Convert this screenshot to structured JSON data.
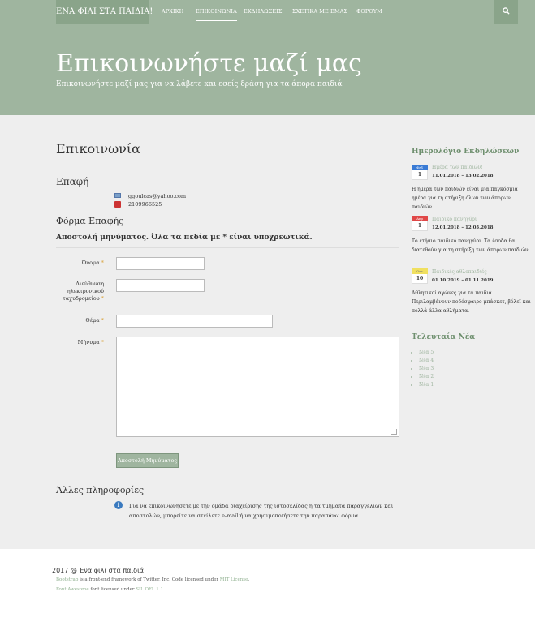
{
  "navbar": {
    "brand": "ΕΝΑ ΦΙΛΙ ΣΤΑ ΠΑΙΔΙΑ!",
    "items": [
      {
        "label": "ΑΡΧΙΚΗ"
      },
      {
        "label": "ΕΠΙΚΟΙΝΩΝΙΑ",
        "active": true
      },
      {
        "label": "ΕΚΔΗΛΩΣΕΙΣ"
      },
      {
        "label": "ΣΧΕΤΙΚΑ ΜΕ ΕΜΑΣ"
      },
      {
        "label": "ΦΟΡΟΥΜ"
      }
    ],
    "search_icon": "search-icon"
  },
  "hero": {
    "title": "Επικοινωνήστε μαζί μας",
    "subtitle": "Επικοινωνήστε μαζί μας για να λάβετε και εσείς δράση για τα άπορα παιδιά"
  },
  "main": {
    "page_title": "Επικοινωνία",
    "contact": {
      "heading": "Επαφή",
      "email": "ggoulcas@yahoo.com",
      "phone": "2109966525"
    },
    "form": {
      "heading": "Φόρμα Επαφής",
      "intro": "Αποστολή μηνύματος. Όλα τα πεδία με * είναι υποχρεωτικά.",
      "name_label": "Όνομα",
      "email_label": "Διεύθυνση ηλεκτρονικού ταχυδρομείου",
      "subject_label": "Θέμα",
      "message_label": "Μήνυμα",
      "required_mark": "*",
      "submit_label": "Αποστολή Μηνύματος"
    },
    "other": {
      "heading": "Άλλες πληροφορίες",
      "text": "Για να επικοινωνήσετε με την ομάδα διαχείρισης της ιστοσελίδας ή τα τμήματα παραγγελιών και αποστολών, μπορείτε να στείλετε e-mail ή να χρησιμοποιήσετε την παραπάνω φόρμα."
    }
  },
  "sidebar": {
    "calendar_heading": "Ημερολόγιο Εκδηλώσεων",
    "events": [
      {
        "month": "Φεβ",
        "day": "1",
        "title": "Ημέρα των παιδιών!",
        "dates": "11.01.2018 – 13.02.2018",
        "description": "Η ημέρα των παιδιών είναι μια παγκόσμια ημέρα για τη στήριξη όλων των άπορων παιδιών.",
        "color": "#3a7bd5"
      },
      {
        "month": "Απρ",
        "day": "1",
        "title": "Παιδικό πανηγύρι",
        "dates": "12.01.2018 – 12.05.2018",
        "description": "Το ετήσιο παιδικό πανηγύρι. Τα έσοδα θα διατεθούν για τη στήριξη των άπορων παιδιών.",
        "color": "#e04848"
      },
      {
        "month": "Οκτ",
        "day": "10",
        "title": "Παιδικές αθλοπαιδιές",
        "dates": "01.10.2019 – 01.11.2019",
        "description": "Αθλητικοί αγώνες για τα παιδιά. Περιλαμβάνουν ποδόσφαιρο μπάσκετ, βόλεϊ και πολλά άλλα αθλήματα.",
        "color": "#f0e060"
      }
    ],
    "news_heading": "Τελευταία Νέα",
    "news": [
      "Νέα 5",
      "Νέα 4",
      "Νέα 3",
      "Νέα 2",
      "Νέα 1"
    ]
  },
  "footer": {
    "copyright": "2017 @ Ένα φιλί στα παιδιά!",
    "bootstrap_link": "Bootstrap",
    "bootstrap_text": " is a front-end framework of Twitter, Inc. Code licensed under ",
    "mit_link": "MIT License",
    "mit_suffix": ".",
    "fontawesome_link": "Font Awesome",
    "fontawesome_text": " font licensed under ",
    "ofl_link": "SIL OFL 1.1",
    "ofl_suffix": "."
  },
  "colors": {
    "brand_green": "#9fb59f",
    "brand_dark": "#8aa48a",
    "sidebar_heading": "#6e8f6e"
  }
}
